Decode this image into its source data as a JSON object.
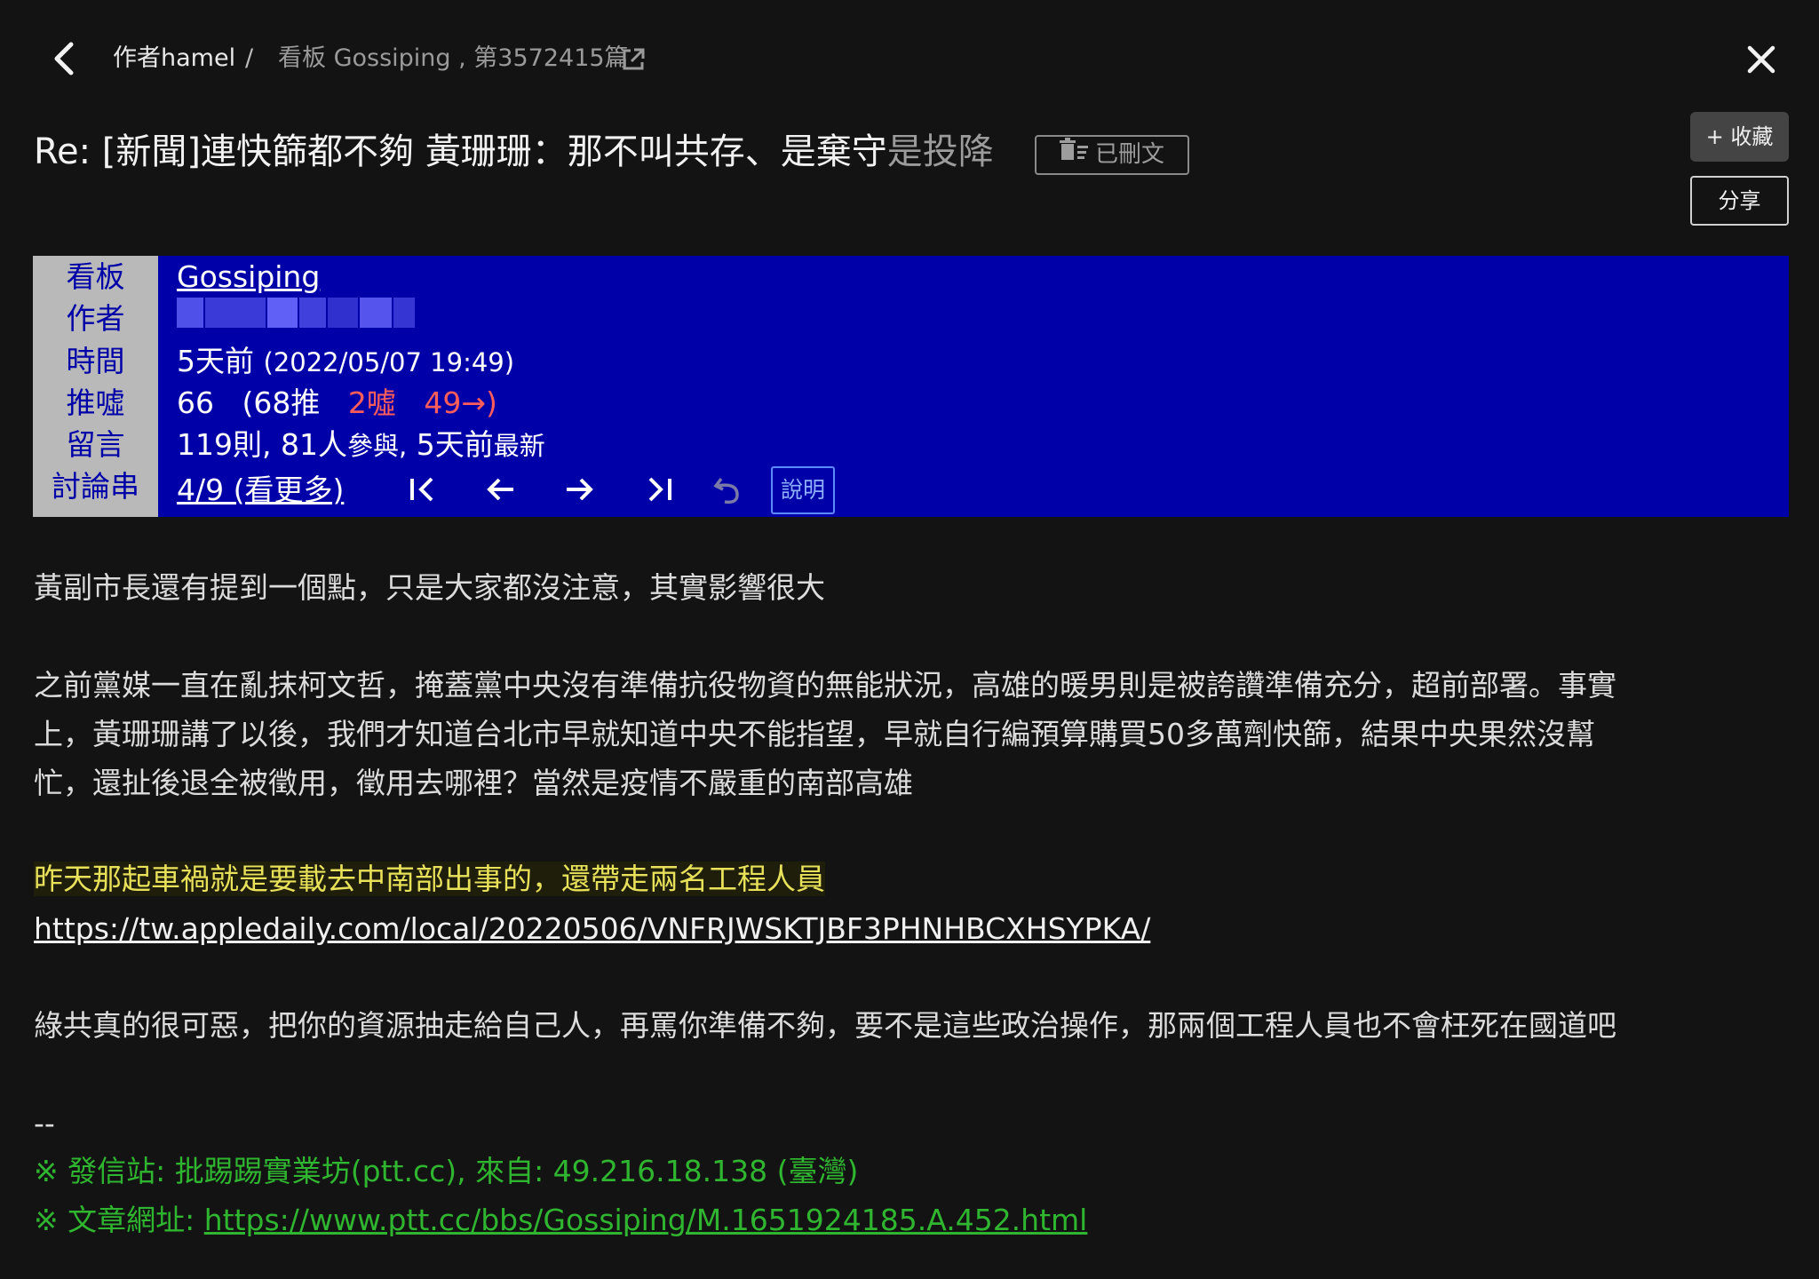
{
  "breadcrumb": {
    "author": "作者hamel",
    "separator": "/",
    "board": "看板 Gossiping , 第3572415篇"
  },
  "title": {
    "main": "Re: [新聞]連快篩都不夠 黃珊珊：那不叫共存、是棄守",
    "tail": "是投降"
  },
  "deleted_badge": "已刪文",
  "buttons": {
    "favorite": "+ 收藏",
    "share": "分享"
  },
  "header": {
    "labels": [
      "看板",
      "作者",
      "時間",
      "推噓",
      "留言",
      "討論串"
    ],
    "board": "Gossiping",
    "time_relative": "5天前",
    "time_absolute": "(2022/05/07 19:49)",
    "score": "66",
    "push": "(68推",
    "boo": "2噓",
    "arrow": "49→)",
    "comments_count": "119則,",
    "participants": "81人",
    "participants_suffix": "參與,",
    "latest": "5天前",
    "latest_suffix": "最新",
    "thread": "4/9 (看更多)",
    "help": "說明"
  },
  "body": {
    "p1": "黃副市長還有提到一個點，只是大家都沒注意，其實影響很大",
    "p2_line1": "之前黨媒一直在亂抹柯文哲，掩蓋黨中央沒有準備抗役物資的無能狀況，高雄的暖男則是被誇讚準備充分，超前部署。事實",
    "p2_line2": "上，黃珊珊講了以後，我們才知道台北市早就知道中央不能指望，早就自行編預算購買50多萬劑快篩，結果中央果然沒幫",
    "p2_line3": "忙，還扯後退全被徵用，徵用去哪裡？當然是疫情不嚴重的南部高雄",
    "highlight": "昨天那起車禍就是要載去中南部出事的，還帶走兩名工程人員",
    "link": "https://tw.appledaily.com/local/20220506/VNFRJWSKTJBF3PHNHBCXHSYPKA/",
    "p3": "綠共真的很可惡，把你的資源抽走給自己人，再罵你準備不夠，要不是這些政治操作，那兩個工程人員也不會枉死在國道吧",
    "signature_sep": "--",
    "sig1": "※ 發信站: 批踢踢實業坊(ptt.cc), 來自: 49.216.18.138 (臺灣)",
    "sig2_prefix": "※ 文章網址: ",
    "sig2_link": "https://www.ptt.cc/bbs/Gossiping/M.1651924185.A.452.html"
  },
  "colors": {
    "header_bg": "#0000a8",
    "label_bg": "#b9b9b9",
    "boo": "#ff5c5c",
    "highlight": "#e8e15a",
    "signature": "#2fb52f"
  }
}
